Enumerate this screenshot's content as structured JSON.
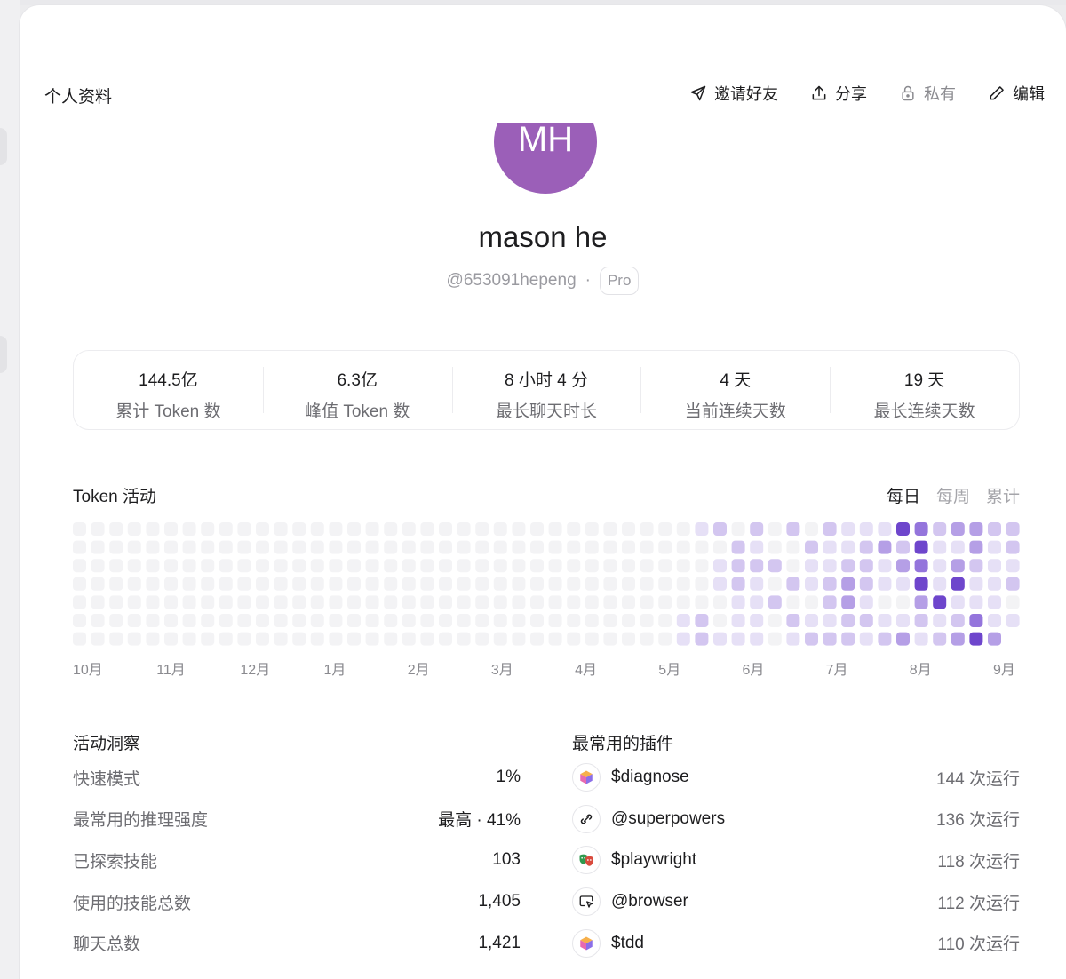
{
  "header": {
    "title": "个人资料",
    "actions": [
      {
        "label": "邀请好友",
        "icon": "send-icon"
      },
      {
        "label": "分享",
        "icon": "share-icon"
      },
      {
        "label": "私有",
        "icon": "lock-icon"
      },
      {
        "label": "编辑",
        "icon": "pencil-icon"
      }
    ]
  },
  "profile": {
    "initials": "MH",
    "avatar_color": "#9b5fb8",
    "name": "mason he",
    "handle": "@653091hepeng",
    "separator": "·",
    "plan": "Pro"
  },
  "stats": [
    {
      "value": "144.5亿",
      "label": "累计 Token 数"
    },
    {
      "value": "6.3亿",
      "label": "峰值 Token 数"
    },
    {
      "value": "8 小时 4 分",
      "label": "最长聊天时长"
    },
    {
      "value": "4 天",
      "label": "当前连续天数"
    },
    {
      "value": "19 天",
      "label": "最长连续天数"
    }
  ],
  "activity": {
    "title": "Token 活动",
    "tabs": [
      {
        "label": "每日",
        "active": true
      },
      {
        "label": "每周",
        "active": false
      },
      {
        "label": "累计",
        "active": false
      }
    ],
    "months": [
      "10月",
      "11月",
      "12月",
      "1月",
      "2月",
      "3月",
      "4月",
      "5月",
      "6月",
      "7月",
      "8月",
      "9月"
    ],
    "colors": [
      "#f3f3f5",
      "#e6e0f6",
      "#d3c6f0",
      "#b59fe6",
      "#9475dc",
      "#6e46cc"
    ],
    "weeks": 52,
    "days_per_week": 7,
    "active_weeks_levels": [
      [
        0,
        0,
        0,
        0,
        0,
        1,
        1
      ],
      [
        1,
        0,
        0,
        0,
        0,
        2,
        2
      ],
      [
        2,
        0,
        1,
        1,
        0,
        0,
        1
      ],
      [
        0,
        2,
        2,
        2,
        1,
        1,
        1
      ],
      [
        2,
        1,
        2,
        1,
        1,
        1,
        1
      ],
      [
        0,
        0,
        2,
        0,
        2,
        0,
        0
      ],
      [
        2,
        0,
        0,
        2,
        0,
        2,
        1
      ],
      [
        0,
        2,
        1,
        1,
        0,
        1,
        2
      ],
      [
        2,
        1,
        1,
        2,
        2,
        1,
        2
      ],
      [
        1,
        1,
        2,
        3,
        3,
        2,
        2
      ],
      [
        1,
        2,
        2,
        2,
        1,
        2,
        1
      ],
      [
        1,
        3,
        1,
        1,
        0,
        1,
        2
      ],
      [
        5,
        2,
        3,
        1,
        0,
        1,
        3
      ],
      [
        4,
        5,
        4,
        5,
        3,
        2,
        1
      ],
      [
        2,
        1,
        1,
        1,
        5,
        1,
        2
      ],
      [
        3,
        1,
        3,
        5,
        1,
        2,
        3
      ],
      [
        3,
        3,
        2,
        1,
        1,
        4,
        5
      ],
      [
        2,
        1,
        1,
        1,
        1,
        1,
        3
      ],
      [
        2,
        2,
        1,
        2,
        0,
        1,
        2
      ]
    ]
  },
  "insights": {
    "title": "活动洞察",
    "rows": [
      {
        "label": "快速模式",
        "value": "1%"
      },
      {
        "label": "最常用的推理强度",
        "value": "最高 · 41%"
      },
      {
        "label": "已探索技能",
        "value": "103"
      },
      {
        "label": "使用的技能总数",
        "value": "1,405"
      },
      {
        "label": "聊天总数",
        "value": "1,421"
      }
    ]
  },
  "plugins": {
    "title": "最常用的插件",
    "rows": [
      {
        "name": "$diagnose",
        "runs": "144 次运行",
        "icon": "cube-icon"
      },
      {
        "name": "@superpowers",
        "runs": "136 次运行",
        "icon": "link-icon"
      },
      {
        "name": "$playwright",
        "runs": "118 次运行",
        "icon": "theater-masks-icon"
      },
      {
        "name": "@browser",
        "runs": "112 次运行",
        "icon": "browser-cursor-icon"
      },
      {
        "name": "$tdd",
        "runs": "110 次运行",
        "icon": "cube-icon"
      }
    ]
  }
}
